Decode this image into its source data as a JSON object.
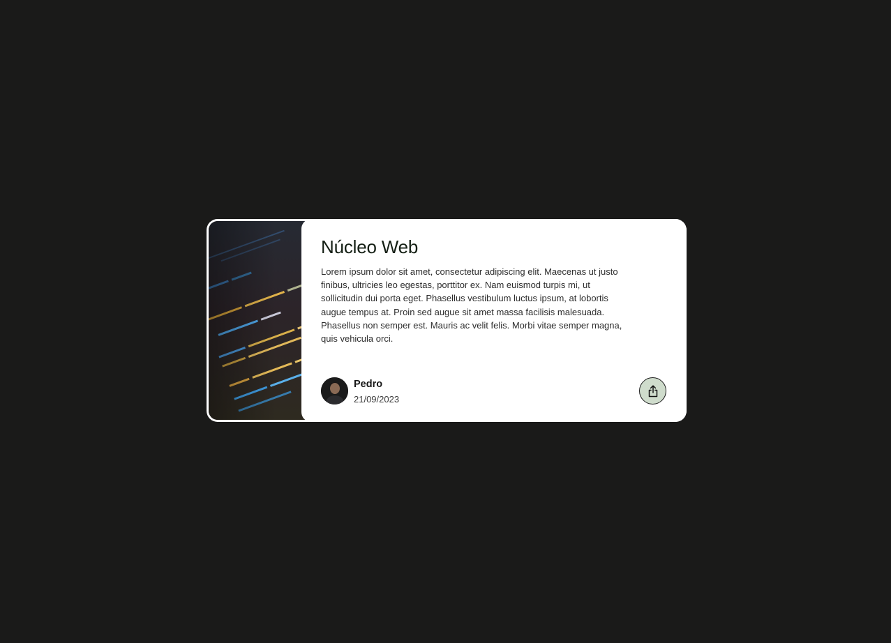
{
  "card": {
    "title": "Núcleo Web",
    "description": "Lorem ipsum dolor sit amet, consectetur adipiscing elit. Maecenas ut justo finibus, ultricies leo egestas, porttitor ex. Nam euismod turpis mi, ut sollicitudin dui porta eget. Phasellus vestibulum luctus ipsum, at lobortis augue tempus at. Proin sed augue sit amet massa facilisis malesuada. Phasellus non semper est. Mauris ac velit felis. Morbi vitae semper magna, quis vehicula orci.",
    "cover_image": "code-screenshot",
    "author": {
      "name": "Pedro",
      "date": "21/09/2023"
    },
    "share_icon": "share-icon"
  },
  "colors": {
    "page_background": "#1a1a19",
    "card_background": "#ffffff",
    "share_button_background": "#cfdccc"
  }
}
